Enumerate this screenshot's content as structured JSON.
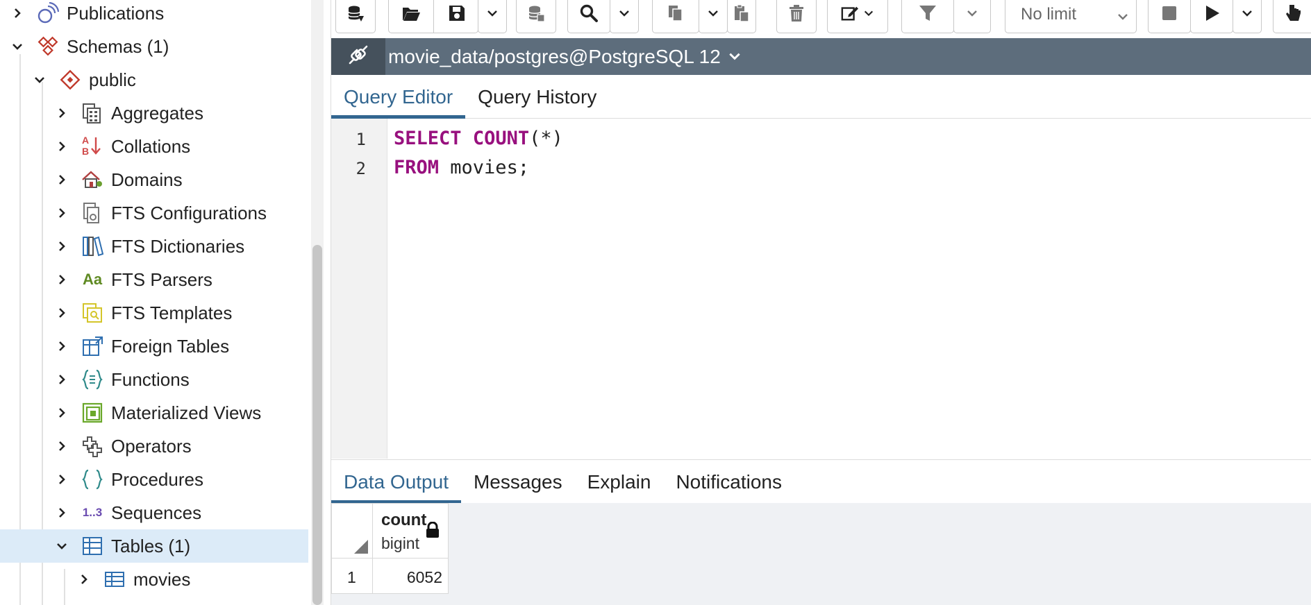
{
  "tree": {
    "items": [
      {
        "label": "Publications",
        "icon": "publications-icon",
        "expanded": false
      },
      {
        "label": "Schemas (1)",
        "icon": "schemas-icon",
        "expanded": true
      },
      {
        "label": "public",
        "icon": "schema-icon",
        "expanded": true
      },
      {
        "label": "Aggregates",
        "icon": "aggregates-icon",
        "expanded": false
      },
      {
        "label": "Collations",
        "icon": "collations-icon",
        "expanded": false
      },
      {
        "label": "Domains",
        "icon": "domains-icon",
        "expanded": false
      },
      {
        "label": "FTS Configurations",
        "icon": "fts-configurations-icon",
        "expanded": false
      },
      {
        "label": "FTS Dictionaries",
        "icon": "fts-dictionaries-icon",
        "expanded": false
      },
      {
        "label": "FTS Parsers",
        "icon": "fts-parsers-icon",
        "expanded": false
      },
      {
        "label": "FTS Templates",
        "icon": "fts-templates-icon",
        "expanded": false
      },
      {
        "label": "Foreign Tables",
        "icon": "foreign-tables-icon",
        "expanded": false
      },
      {
        "label": "Functions",
        "icon": "functions-icon",
        "expanded": false
      },
      {
        "label": "Materialized Views",
        "icon": "materialized-views-icon",
        "expanded": false
      },
      {
        "label": "Operators",
        "icon": "operators-icon",
        "expanded": false
      },
      {
        "label": "Procedures",
        "icon": "procedures-icon",
        "expanded": false
      },
      {
        "label": "Sequences",
        "icon": "sequences-icon",
        "expanded": false
      },
      {
        "label": "Tables (1)",
        "icon": "tables-icon",
        "expanded": true,
        "selected": true
      },
      {
        "label": "movies",
        "icon": "table-icon",
        "expanded": false
      }
    ],
    "sequences_icon_text": "1..3",
    "fts_parsers_icon_text": "Aa",
    "collations_icon_text_a": "A",
    "collations_icon_text_b": "B"
  },
  "toolbar": {
    "limit_label": "No limit"
  },
  "connection": {
    "title": "movie_data/postgres@PostgreSQL 12"
  },
  "editor_tabs": {
    "query_editor": "Query Editor",
    "query_history": "Query History"
  },
  "editor": {
    "lines": [
      {
        "number": "1",
        "keyword1": "SELECT",
        "keyword2": "COUNT",
        "rest": "(*)"
      },
      {
        "number": "2",
        "keyword1": "FROM",
        "rest": " movies;"
      }
    ]
  },
  "output_tabs": {
    "data_output": "Data Output",
    "messages": "Messages",
    "explain": "Explain",
    "notifications": "Notifications"
  },
  "result": {
    "column_name": "count",
    "column_type": "bigint",
    "rows": [
      {
        "row_number": "1",
        "count": "6052"
      }
    ]
  },
  "colors": {
    "keyword": "#98107e",
    "accent": "#326690",
    "conn_bar": "#5d6d7c",
    "selected_row": "#dcebf8"
  }
}
